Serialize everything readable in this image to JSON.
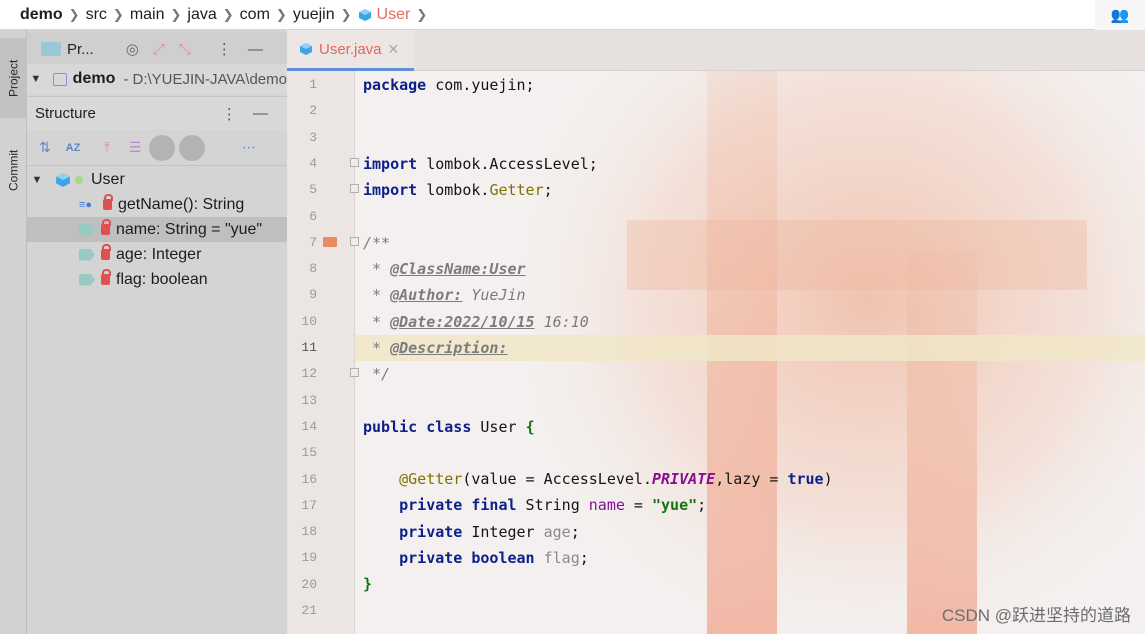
{
  "breadcrumb": [
    "demo",
    "src",
    "main",
    "java",
    "com",
    "yuejin",
    "User"
  ],
  "left_strip": {
    "project_tab": "Project",
    "commit_tab": "Commit"
  },
  "project_panel": {
    "title": "Pr...",
    "root_name": "demo",
    "root_path": "- D:\\YUEJIN-JAVA\\demo"
  },
  "structure_panel": {
    "title": "Structure",
    "class_name": "User",
    "members": [
      {
        "label": "getName(): String",
        "kind": "method",
        "selected": false
      },
      {
        "label": "name: String = \"yue\"",
        "kind": "field",
        "selected": true
      },
      {
        "label": "age: Integer",
        "kind": "field",
        "selected": false
      },
      {
        "label": "flag: boolean",
        "kind": "field",
        "selected": false
      }
    ]
  },
  "editor": {
    "tab_label": "User.java",
    "line_numbers": [
      "1",
      "2",
      "3",
      "4",
      "5",
      "6",
      "7",
      "8",
      "9",
      "10",
      "11",
      "12",
      "13",
      "14",
      "15",
      "16",
      "17",
      "18",
      "19",
      "20",
      "21"
    ],
    "current_line": "11"
  },
  "code": {
    "l1_kw": "package",
    "l1_rest": " com.yuejin;",
    "l4_kw": "import",
    "l4_rest": " lombok.AccessLevel;",
    "l5_kw": "import",
    "l5_a": " lombok.",
    "l5_ann": "Getter",
    "l5_end": ";",
    "l7": "/**",
    "l8_star": " * ",
    "l8_tag": "@ClassName:User",
    "l9_star": " * ",
    "l9_tag": "@Author:",
    "l9_val": " YueJin",
    "l10_star": " * ",
    "l10_tag": "@Date:2022/10/15",
    "l10_val": " 16:10",
    "l11_star": " * ",
    "l11_tag": "@Description:",
    "l12": " */",
    "l14_kw1": "public",
    "l14_kw2": "class",
    "l14_rest": " User ",
    "l14_brace": "{",
    "l16_ann": "@Getter",
    "l16_a": "(value = AccessLevel.",
    "l16_const": "PRIVATE",
    "l16_b": ",lazy = ",
    "l16_kw": "true",
    "l16_end": ")",
    "l17_kw1": "private",
    "l17_kw2": "final",
    "l17_a": " String ",
    "l17_fld": "name",
    "l17_b": " = ",
    "l17_str": "\"yue\"",
    "l17_end": ";",
    "l18_kw": "private",
    "l18_a": " Integer ",
    "l18_fld": "age",
    "l18_end": ";",
    "l19_kw1": "private",
    "l19_kw2": "boolean",
    "l19_fld": "flag",
    "l19_end": ";",
    "l20": "}"
  },
  "watermark": "CSDN @跃进坚持的道路",
  "colors": {
    "accent_tab": "#5f8fd8",
    "active_crumb": "#e46d5b"
  }
}
